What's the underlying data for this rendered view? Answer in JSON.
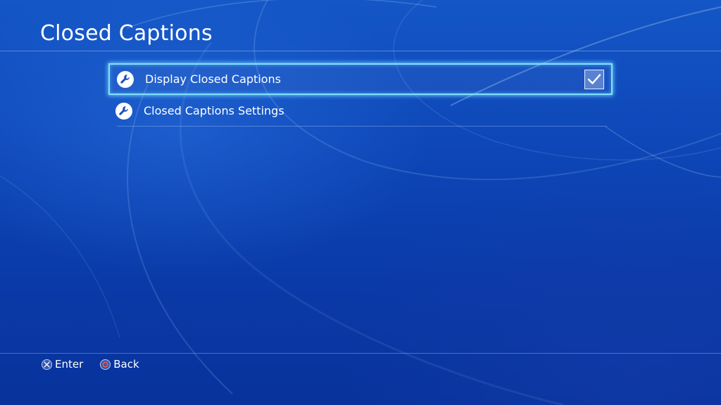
{
  "header": {
    "title": "Closed Captions"
  },
  "menu": {
    "items": [
      {
        "label": "Display Closed Captions",
        "icon": "wrench-icon",
        "focused": true,
        "control": "checkbox",
        "checked": true
      },
      {
        "label": "Closed Captions Settings",
        "icon": "wrench-icon",
        "focused": false
      }
    ]
  },
  "footer": {
    "enter_label": "Enter",
    "enter_icon": "cross-button-icon",
    "back_label": "Back",
    "back_icon": "circle-button-icon"
  },
  "colors": {
    "background": "#0a3aa8",
    "focus_outline": "#7fe0ff",
    "circle_button": "#ff5a3c"
  }
}
